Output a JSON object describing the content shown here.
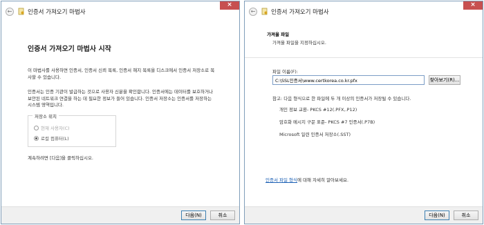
{
  "window1": {
    "title": "인증서 가져오기 마법사",
    "close_label": "×",
    "heading": "인증서 가져오기 마법사 시작",
    "paragraph1": "이 마법사를 사용하면 인증서, 인증서 신뢰 목록, 인증서 해지 목록을 디스크에서 인증서 저장소로 복사할 수 있습니다.",
    "paragraph2": "인증서는 인증 기관이 발급하는 것으로 사용자 신분을 확인합니다. 인증서에는 데이터를 보호하거나 보안된 네트워크 연결을 하는 데 필요한 정보가 들어 있습니다. 인증서 저장소는 인증서를 저장하는 시스템 영역입니다.",
    "store_location": {
      "legend": "저장소 위치",
      "options": [
        {
          "label": "현재 사용자(C)",
          "selected": false,
          "enabled": false
        },
        {
          "label": "로컬 컴퓨터(L)",
          "selected": true,
          "enabled": true
        }
      ]
    },
    "continue_text": "계속하려면 [다음]을 클릭하십시오.",
    "next_label": "다음(N)",
    "cancel_label": "취소"
  },
  "window2": {
    "title": "인증서 가져오기 마법사",
    "close_label": "×",
    "section_title": "가져올 파일",
    "section_subtitle": "가져올 파일을 지정하십시오.",
    "file_name_label": "파일 이름(F):",
    "file_name_value": "C:\\SSL인증서\\www.certkorea.co.kr.pfx",
    "browse_label": "찾아보기(R)...",
    "note": "참고: 다음 형식으로 한 파일에 두 개 이상의 인증서가 저장될 수 있습니다.",
    "formats": [
      "개인 정보 교환- PKCS #12(.PFX,.P12)",
      "암호화 메시지 구문 표준- PKCS #7 인증서(.P7B)",
      "Microsoft 일련 인증서 저장소(.SST)"
    ],
    "link_text": "인증서 파일 형식",
    "link_suffix": "에 대해 자세히 알아보세요.",
    "next_label": "다음(N)",
    "cancel_label": "취소"
  }
}
